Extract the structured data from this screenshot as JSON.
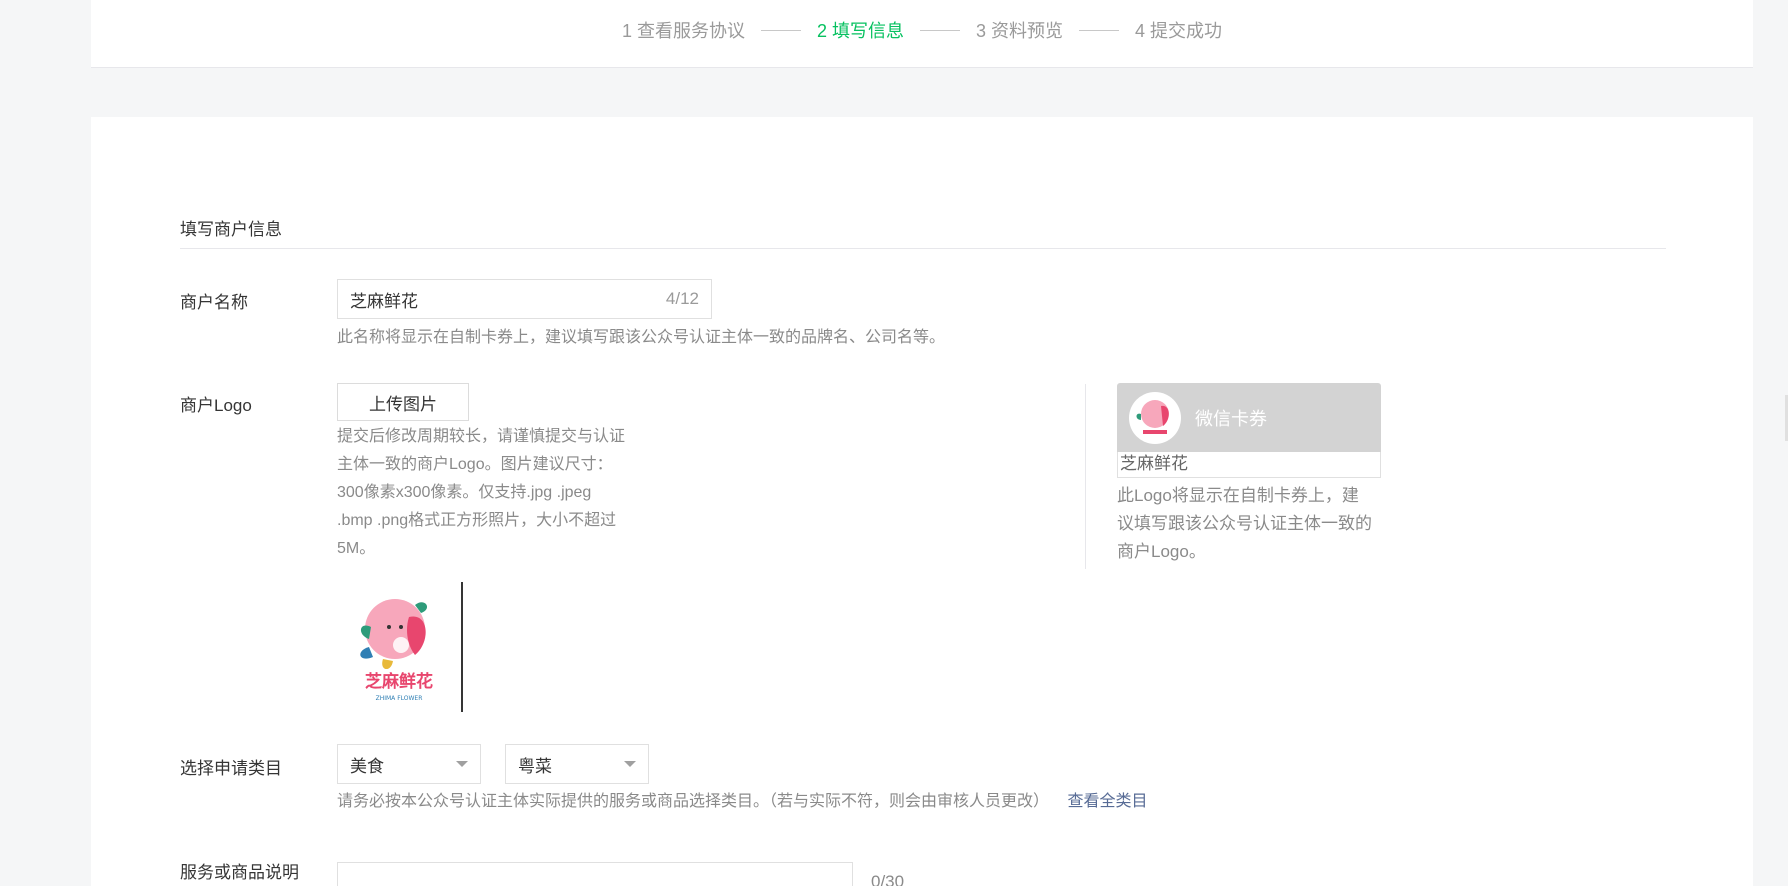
{
  "steps": [
    {
      "label": "1 查看服务协议",
      "active": false
    },
    {
      "label": "2 填写信息",
      "active": true
    },
    {
      "label": "3 资料预览",
      "active": false
    },
    {
      "label": "4 提交成功",
      "active": false
    }
  ],
  "form": {
    "section_title": "填写商户信息",
    "merchant_name": {
      "label": "商户名称",
      "value": "芝麻鲜花",
      "count": "4/12",
      "tip": "此名称将显示在自制卡券上，建议填写跟该公众号认证主体一致的品牌名、公司名等。"
    },
    "logo": {
      "label": "商户Logo",
      "upload_button": "上传图片",
      "tip_lines": [
        "提交后修改周期较长，请谨慎提交与认证",
        "主体一致的商户Logo。图片建议尺寸：",
        "300像素x300像素。仅支持.jpg .jpeg",
        ".bmp .png格式正方形照片，大小不超过",
        "5M。"
      ],
      "image_text": "芝麻鲜花",
      "image_subtext": "ZHIMA FLOWER"
    },
    "preview": {
      "title": "微信卡券",
      "merchant_name": "芝麻鲜花",
      "tip_lines": [
        "此Logo将显示在自制卡券上，建",
        "议填写跟该公众号认证主体一致的",
        "商户Logo。"
      ]
    },
    "category": {
      "label": "选择申请类目",
      "primary": "美食",
      "secondary": "粤菜",
      "tip": "请务必按本公众号认证主体实际提供的服务或商品选择类目。（若与实际不符，则会由审核人员更改）",
      "link": "查看全类目"
    },
    "description": {
      "label": "服务或商品说明",
      "value": "",
      "count": "0/30"
    }
  },
  "colors": {
    "active_step": "#07c160",
    "link": "#576b95",
    "brand_pink": "#f06a8e"
  }
}
